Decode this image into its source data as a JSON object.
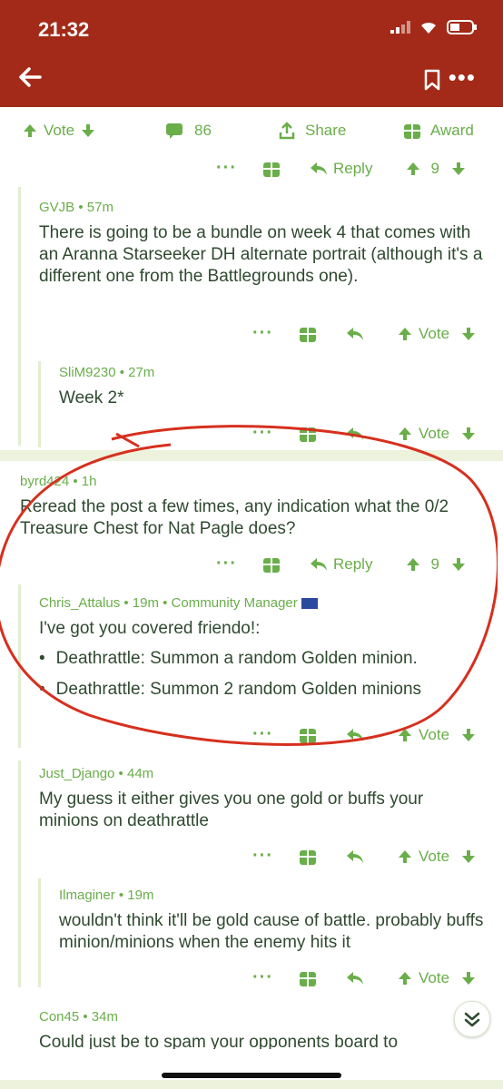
{
  "status": {
    "time": "21:32"
  },
  "post_actions": {
    "vote": "Vote",
    "comments": "86",
    "share": "Share",
    "award": "Award"
  },
  "reply_label": "Reply",
  "vote_label": "Vote",
  "dots": "···",
  "comments": [
    {
      "meta": "GVJB • 57m",
      "body": "There is going to be a bundle on week 4 that comes with an Aranna Starseeker DH alternate portrait (although it's a different one from the Battlegrounds one)."
    },
    {
      "meta": "SliM9230 • 27m",
      "body": "Week 2*"
    },
    {
      "meta": "byrd424 • 1h",
      "body": "Reread the post a few times, any indication what the 0/2 Treasure Chest for Nat Pagle does?",
      "score": "9"
    },
    {
      "meta": "Chris_Attalus • 19m • Community Manager",
      "body": "I've got you covered friendo!:",
      "bullets": [
        "Deathrattle: Summon a random Golden minion.",
        "Deathrattle: Summon 2 random Golden minions"
      ]
    },
    {
      "meta": "Just_Django • 44m",
      "body": "My guess it either gives you one gold or buffs your minions on deathrattle"
    },
    {
      "meta": "Ilmaginer • 19m",
      "body": "wouldn't think it'll be gold cause of battle. probably buffs minion/minions when the enemy hits it"
    },
    {
      "meta": "Con45 • 34m",
      "body": "Could just be to spam your opponents board to"
    }
  ],
  "top_reply_score": "9"
}
